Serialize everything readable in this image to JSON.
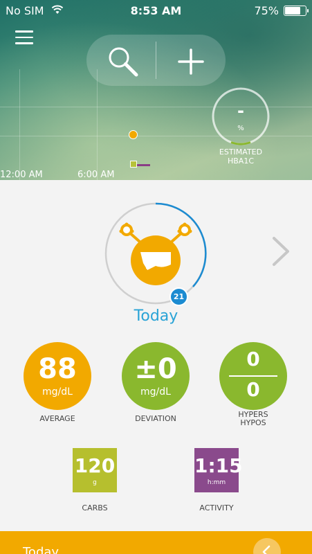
{
  "status_bar": {
    "carrier": "No SIM",
    "time": "8:53 AM",
    "battery": "75%",
    "battery_level": 0.75
  },
  "hero": {
    "icons": {
      "menu": "hamburger-menu-icon",
      "search": "search-icon",
      "add": "plus-icon"
    },
    "hba1c": {
      "value": "-",
      "unit": "%",
      "label_line1": "ESTIMATED",
      "label_line2": "HBA1C"
    },
    "time_labels": [
      "12:00 AM",
      "6:00 AM"
    ],
    "colors": {
      "glucose_dot": "#f2a900",
      "carb_marker": "#b6c23a",
      "activity_marker": "#8a3d86"
    }
  },
  "summary": {
    "badge": "21",
    "period": "Today",
    "ring_progress": 0.33,
    "colors": {
      "ring_track": "#cfcfcf",
      "ring_progress": "#1b8bd1",
      "monster": "#f2a900"
    }
  },
  "stats": {
    "average": {
      "value": "88",
      "unit": "mg/dL",
      "label": "AVERAGE"
    },
    "deviation": {
      "value": "±0",
      "unit": "mg/dL",
      "label": "DEVIATION"
    },
    "hypers_hypos": {
      "hypers": "0",
      "hypos": "0",
      "label_line1": "HYPERS",
      "label_line2": "HYPOS"
    }
  },
  "tiles": {
    "carbs": {
      "value": "120",
      "unit": "g",
      "label": "CARBS"
    },
    "activity": {
      "value": "1:15",
      "unit": "h:mm",
      "label": "ACTIVITY"
    }
  },
  "bottom": {
    "label": "Today"
  }
}
